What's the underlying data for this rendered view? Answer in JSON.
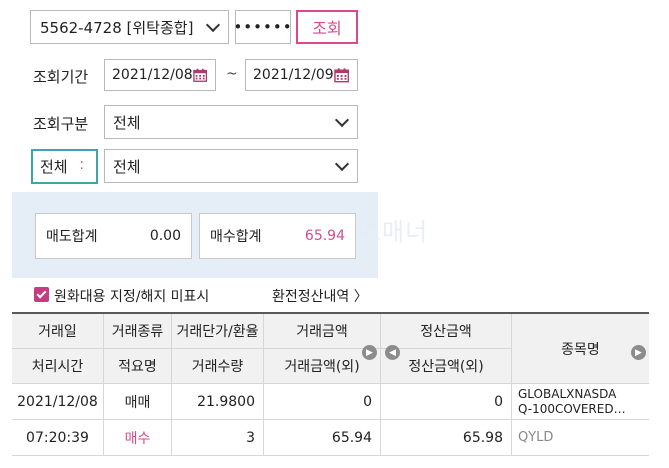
{
  "account": {
    "value": "5562-4728 [위탁종합]",
    "password": "••••••",
    "query_button": "조회"
  },
  "period": {
    "label": "조회기간",
    "from": "2021/12/08",
    "to": "2021/12/09",
    "separator": "~"
  },
  "kind": {
    "label": "조회구분",
    "value": "전체"
  },
  "filter": {
    "left_value": "전체",
    "right_value": "전체"
  },
  "summary": {
    "sell_total_label": "매도합계",
    "sell_total_value": "0.00",
    "buy_total_label": "매수합계",
    "buy_total_value": "65.94",
    "watermark": "뉴스레터 노매너"
  },
  "options": {
    "checkbox_label": "원화대용 지정/해지 미표시",
    "checked": true,
    "fx_link": "환전정산내역 〉"
  },
  "table": {
    "headers_row1": [
      "거래일",
      "거래종류",
      "거래단가/환율",
      "거래금액",
      "정산금액",
      "종목명"
    ],
    "headers_row2": [
      "처리시간",
      "적요명",
      "거래수량",
      "거래금액(외)",
      "정산금액(외)"
    ],
    "rows": [
      {
        "line1": [
          "2021/12/08",
          "매매",
          "21.9800",
          "0",
          "0",
          "GLOBALXNASDA",
          "Q-100COVERED…"
        ],
        "line2": [
          "07:20:39",
          "매수",
          "3",
          "65.94",
          "65.98",
          "QYLD"
        ]
      }
    ]
  },
  "colors": {
    "accent": "#d94a8c",
    "teal": "#3fa5a9",
    "panel": "#e5edf6"
  }
}
